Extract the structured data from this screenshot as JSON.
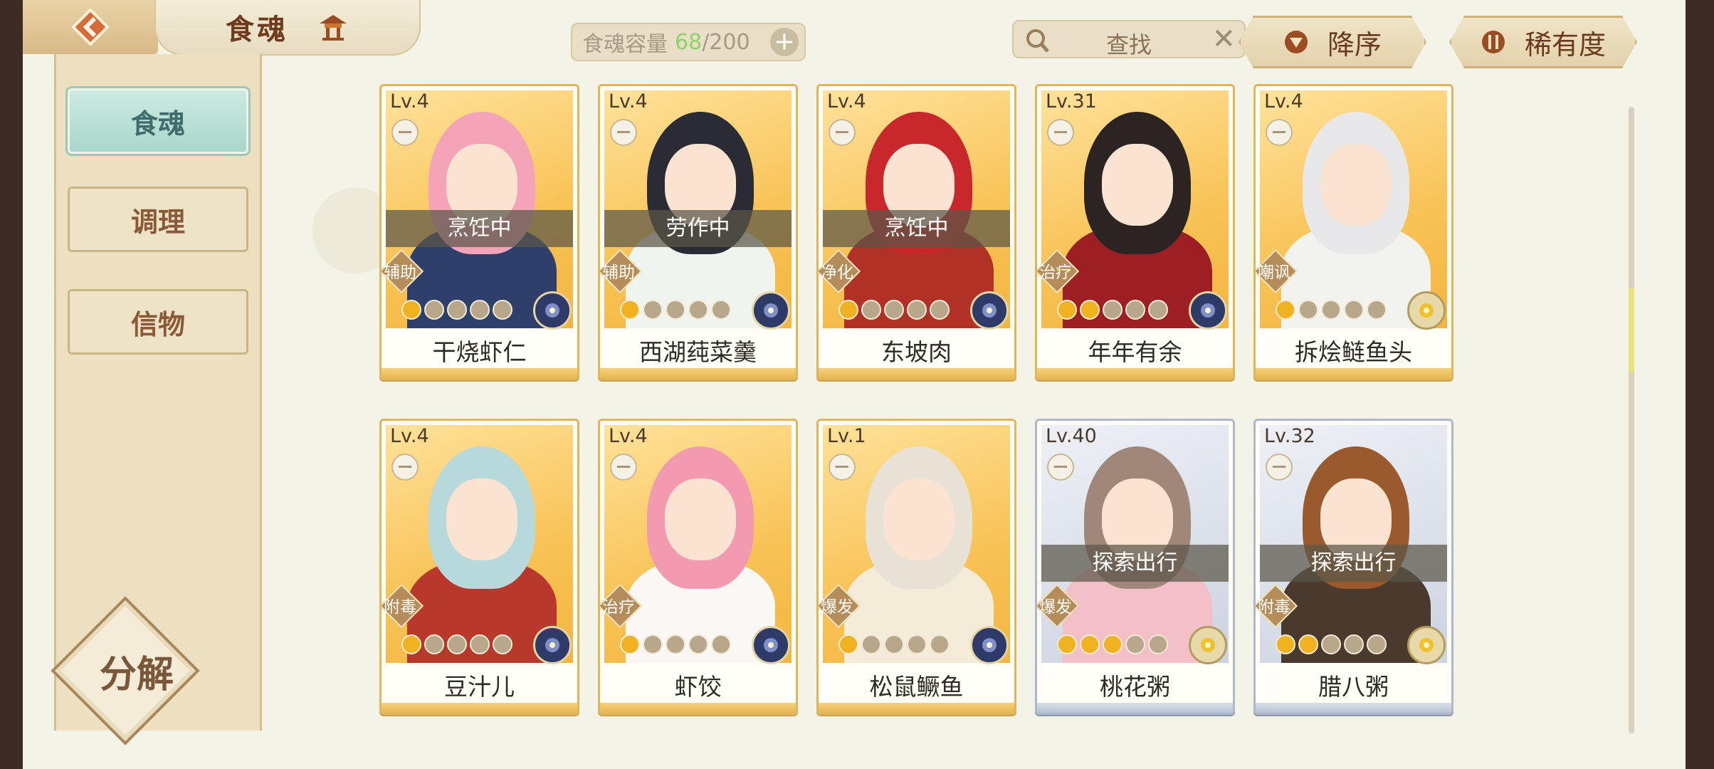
{
  "header": {
    "title": "食魂",
    "capacity_label": "食魂容量",
    "capacity_current": "68",
    "capacity_total": "/200",
    "search_label": "查找",
    "sort_order_label": "降序",
    "sort_by_label": "稀有度"
  },
  "sidebar": {
    "tabs": [
      {
        "label": "食魂"
      },
      {
        "label": "调理"
      },
      {
        "label": "信物"
      }
    ],
    "decompose_label": "分解"
  },
  "colors": {
    "accent_gold": "#e0b65a",
    "accent_teal": "#a8d6cb",
    "capacity_green": "#8dd26b"
  },
  "cards": [
    {
      "level": "Lv.4",
      "name": "干烧虾仁",
      "status": "烹饪中",
      "role": "辅助",
      "stars": 1,
      "emblem": "blue",
      "frame": "gold"
    },
    {
      "level": "Lv.4",
      "name": "西湖莼菜羹",
      "status": "劳作中",
      "role": "辅助",
      "stars": 1,
      "emblem": "blue",
      "frame": "gold"
    },
    {
      "level": "Lv.4",
      "name": "东坡肉",
      "status": "烹饪中",
      "role": "净化",
      "stars": 1,
      "emblem": "blue",
      "frame": "gold"
    },
    {
      "level": "Lv.31",
      "name": "年年有余",
      "status": "",
      "role": "治疗",
      "stars": 2,
      "emblem": "blue",
      "frame": "gold"
    },
    {
      "level": "Lv.4",
      "name": "拆烩鲢鱼头",
      "status": "",
      "role": "嘲讽",
      "stars": 1,
      "emblem": "gold",
      "frame": "gold"
    },
    {
      "level": "Lv.4",
      "name": "豆汁儿",
      "status": "",
      "role": "附毒",
      "stars": 1,
      "emblem": "blue",
      "frame": "gold"
    },
    {
      "level": "Lv.4",
      "name": "虾饺",
      "status": "",
      "role": "治疗",
      "stars": 1,
      "emblem": "blue",
      "frame": "gold"
    },
    {
      "level": "Lv.1",
      "name": "松鼠鳜鱼",
      "status": "",
      "role": "爆发",
      "stars": 1,
      "emblem": "blue",
      "frame": "gold"
    },
    {
      "level": "Lv.40",
      "name": "桃花粥",
      "status": "探索出行",
      "role": "爆发",
      "stars": 3,
      "emblem": "gold",
      "frame": "silver"
    },
    {
      "level": "Lv.32",
      "name": "腊八粥",
      "status": "探索出行",
      "role": "附毒",
      "stars": 2,
      "emblem": "gold",
      "frame": "silver"
    }
  ]
}
